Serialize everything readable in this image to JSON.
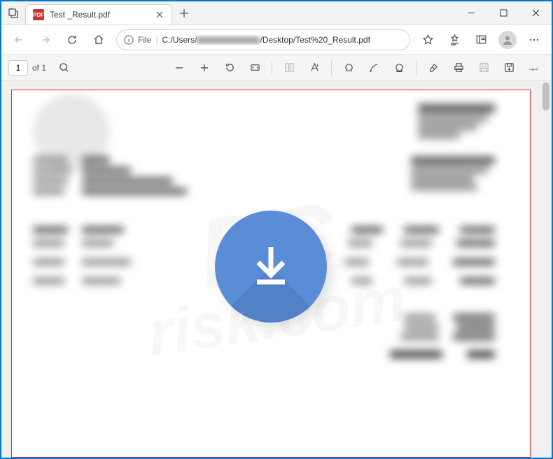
{
  "window": {
    "tab_title": "Test _Result.pdf",
    "tab_icon_text": "PDF"
  },
  "address": {
    "file_label": "File",
    "url_prefix": "C:/Users/",
    "url_suffix": "/Desktop/Test%20_Result.pdf"
  },
  "pdf_toolbar": {
    "page_current": "1",
    "page_of_label": "of 1"
  },
  "watermark": {
    "line1": "PC",
    "line2": "risk.com"
  }
}
